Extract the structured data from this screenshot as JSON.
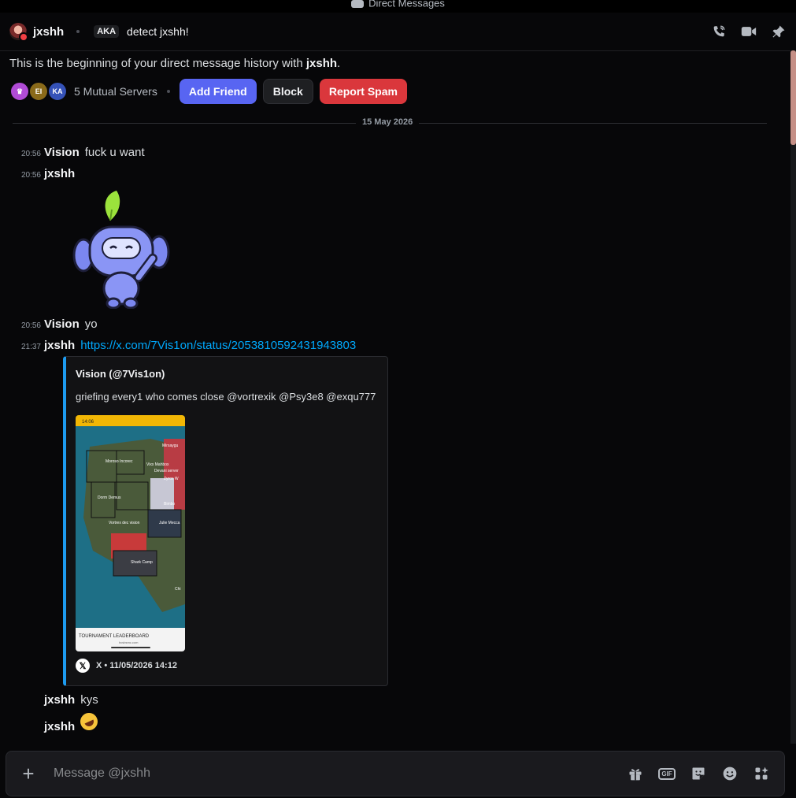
{
  "titlebar": {
    "title": "Direct Messages"
  },
  "header": {
    "username": "jxshh",
    "aka_label": "AKA",
    "nickname": "detect jxshh!",
    "icons": [
      "phone-icon",
      "video-icon",
      "pin-icon"
    ]
  },
  "intro": {
    "prefix": "This is the beginning of your direct message history with ",
    "username": "jxshh",
    "suffix": "."
  },
  "mutual": {
    "servers": [
      {
        "label": "",
        "color": "#b04bd6"
      },
      {
        "label": "EI",
        "color": "#8a6a1a"
      },
      {
        "label": "KA",
        "color": "#3552b8"
      }
    ],
    "label": "5 Mutual Servers"
  },
  "actions": {
    "add_friend": "Add Friend",
    "block": "Block",
    "report_spam": "Report Spam"
  },
  "date_divider": "15 May 2026",
  "messages": [
    {
      "time": "20:56",
      "author": "Vision",
      "text": "fuck u want"
    },
    {
      "time": "20:56",
      "author": "jxshh",
      "text": ""
    },
    {
      "time": "20:56",
      "author": "Vision",
      "text": "yo"
    },
    {
      "time": "21:37",
      "author": "jxshh",
      "link": "https://x.com/7Vis1on/status/2053810592431943803"
    },
    {
      "time": "",
      "author": "jxshh",
      "text": "kys"
    },
    {
      "time": "",
      "author": "jxshh",
      "emoji": "rolling-on-floor-laughing"
    }
  ],
  "embed": {
    "author": "Vision (@7Vis1on)",
    "description": "griefing every1 who comes close @vortrexik @Psy3e8 @exqu777",
    "image": {
      "status_time": "14:06",
      "map_labels": [
        "Mofiow",
        "Mirsaygu",
        "Moroso Incorec",
        "Vixx Mahbox",
        "Devani server",
        "Zyrox W",
        "Dorm Demus",
        "Vortrex dec vision",
        "Bimbo",
        "Julie Mecca",
        "Shark Camp",
        "Chi"
      ],
      "bottom_text": "TOURNAMENT LEADERBOARD",
      "bottom_sub": "hcsbsmc.com"
    },
    "footer": "X • 11/05/2026 14:12",
    "accent": "#1d9bf0"
  },
  "composer": {
    "placeholder": "Message @jxshh",
    "icons": [
      "gift-icon",
      "gif-icon",
      "sticker-icon",
      "emoji-icon",
      "apps-icon"
    ],
    "gif_label": "GIF"
  }
}
